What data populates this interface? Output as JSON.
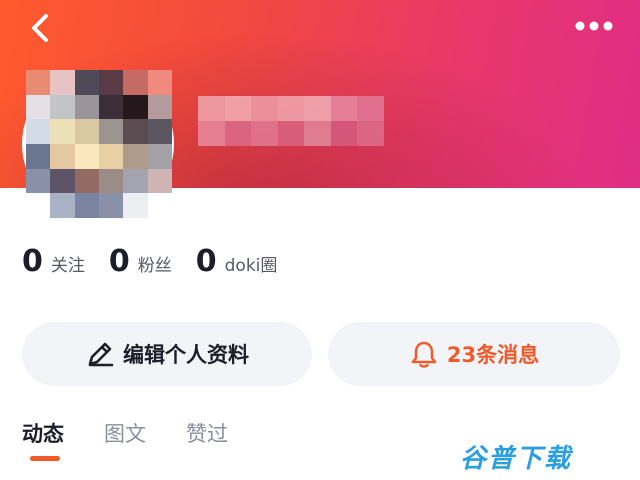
{
  "header": {
    "back_icon": "chevron-left-icon",
    "more_icon": "more-horizontal-icon",
    "gradient": [
      "#ff5a2e",
      "#e02d86"
    ]
  },
  "profile": {
    "avatar_state": "pixelated",
    "name_state": "pixelated"
  },
  "stats": [
    {
      "value": "0",
      "label": "关注"
    },
    {
      "value": "0",
      "label": "粉丝"
    },
    {
      "value": "0",
      "label": "doki圈"
    }
  ],
  "actions": {
    "edit_label": "编辑个人资料",
    "edit_icon": "pencil-icon",
    "messages_label": "23条消息",
    "messages_icon": "bell-icon",
    "accent": "#f05a2a"
  },
  "tabs": [
    {
      "label": "动态",
      "active": true
    },
    {
      "label": "图文",
      "active": false
    },
    {
      "label": "赞过",
      "active": false
    }
  ],
  "watermark": "谷普下载"
}
